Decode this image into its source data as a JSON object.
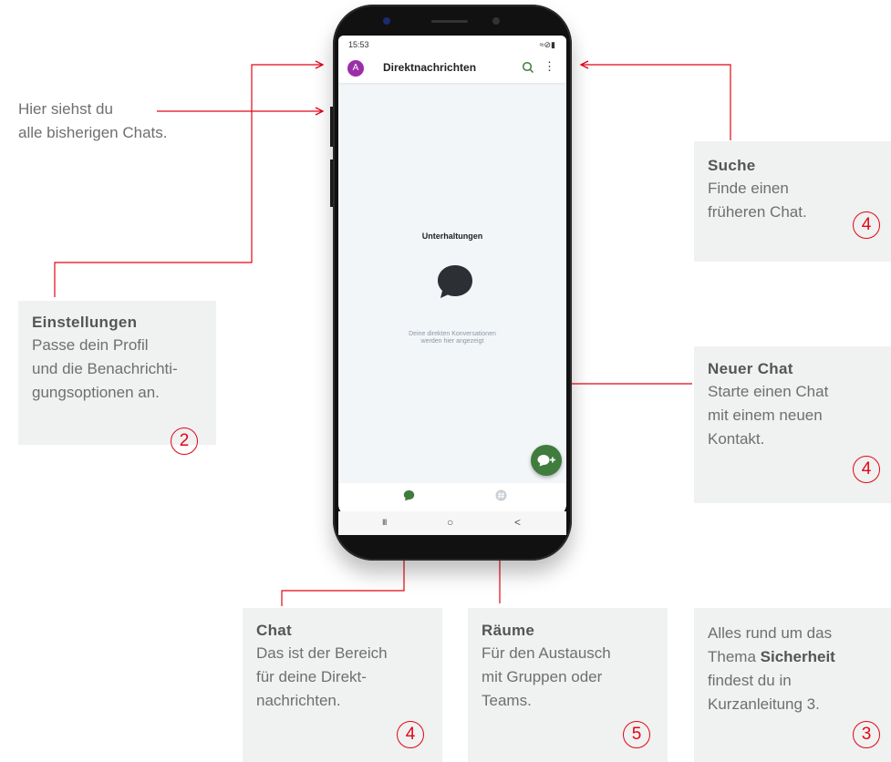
{
  "phone": {
    "status_time": "15:53",
    "status_right": "≈⊘▮",
    "app_title": "Direktnachrichten",
    "avatar_letter": "A",
    "empty_title": "Unterhaltungen",
    "empty_line1": "Deine direkten Konversationen",
    "empty_line2": "werden hier angezeigt",
    "nav_chat_icon": "chat-bubble-icon",
    "nav_rooms_icon": "hash-icon",
    "sys_recent": "III",
    "sys_home": "○",
    "sys_back": "<"
  },
  "annotations": {
    "chats_hint": {
      "line1": "Hier siehst du",
      "line2": "alle bisherigen Chats."
    },
    "settings": {
      "title": "Einstellungen",
      "lines": [
        "Passe dein Profil",
        "und die Benachrichti-",
        "gungsoptionen an."
      ],
      "num": "2"
    },
    "search": {
      "title": "Suche",
      "lines": [
        "Finde einen",
        "früheren Chat."
      ],
      "num": "4"
    },
    "new_chat": {
      "title": "Neuer Chat",
      "lines": [
        "Starte einen Chat",
        "mit einem neuen",
        "Kontakt."
      ],
      "num": "4"
    },
    "chat": {
      "title": "Chat",
      "lines": [
        "Das ist der Bereich",
        "für deine Direkt-",
        "nachrichten."
      ],
      "num": "4"
    },
    "rooms": {
      "title": "Räume",
      "lines": [
        "Für den Austausch",
        "mit Gruppen oder",
        "Teams."
      ],
      "num": "5"
    },
    "security": {
      "line1": "Alles rund um das",
      "line2_pre": "Thema ",
      "line2_bold": "Sicherheit",
      "line3": "findest du in",
      "line4": "Kurzanleitung 3.",
      "num": "3"
    }
  },
  "colors": {
    "accent_red": "#e30613",
    "fab_green": "#3f7c3d",
    "avatar_purple": "#9b2ea8",
    "box_gray": "#f0f1f1"
  }
}
